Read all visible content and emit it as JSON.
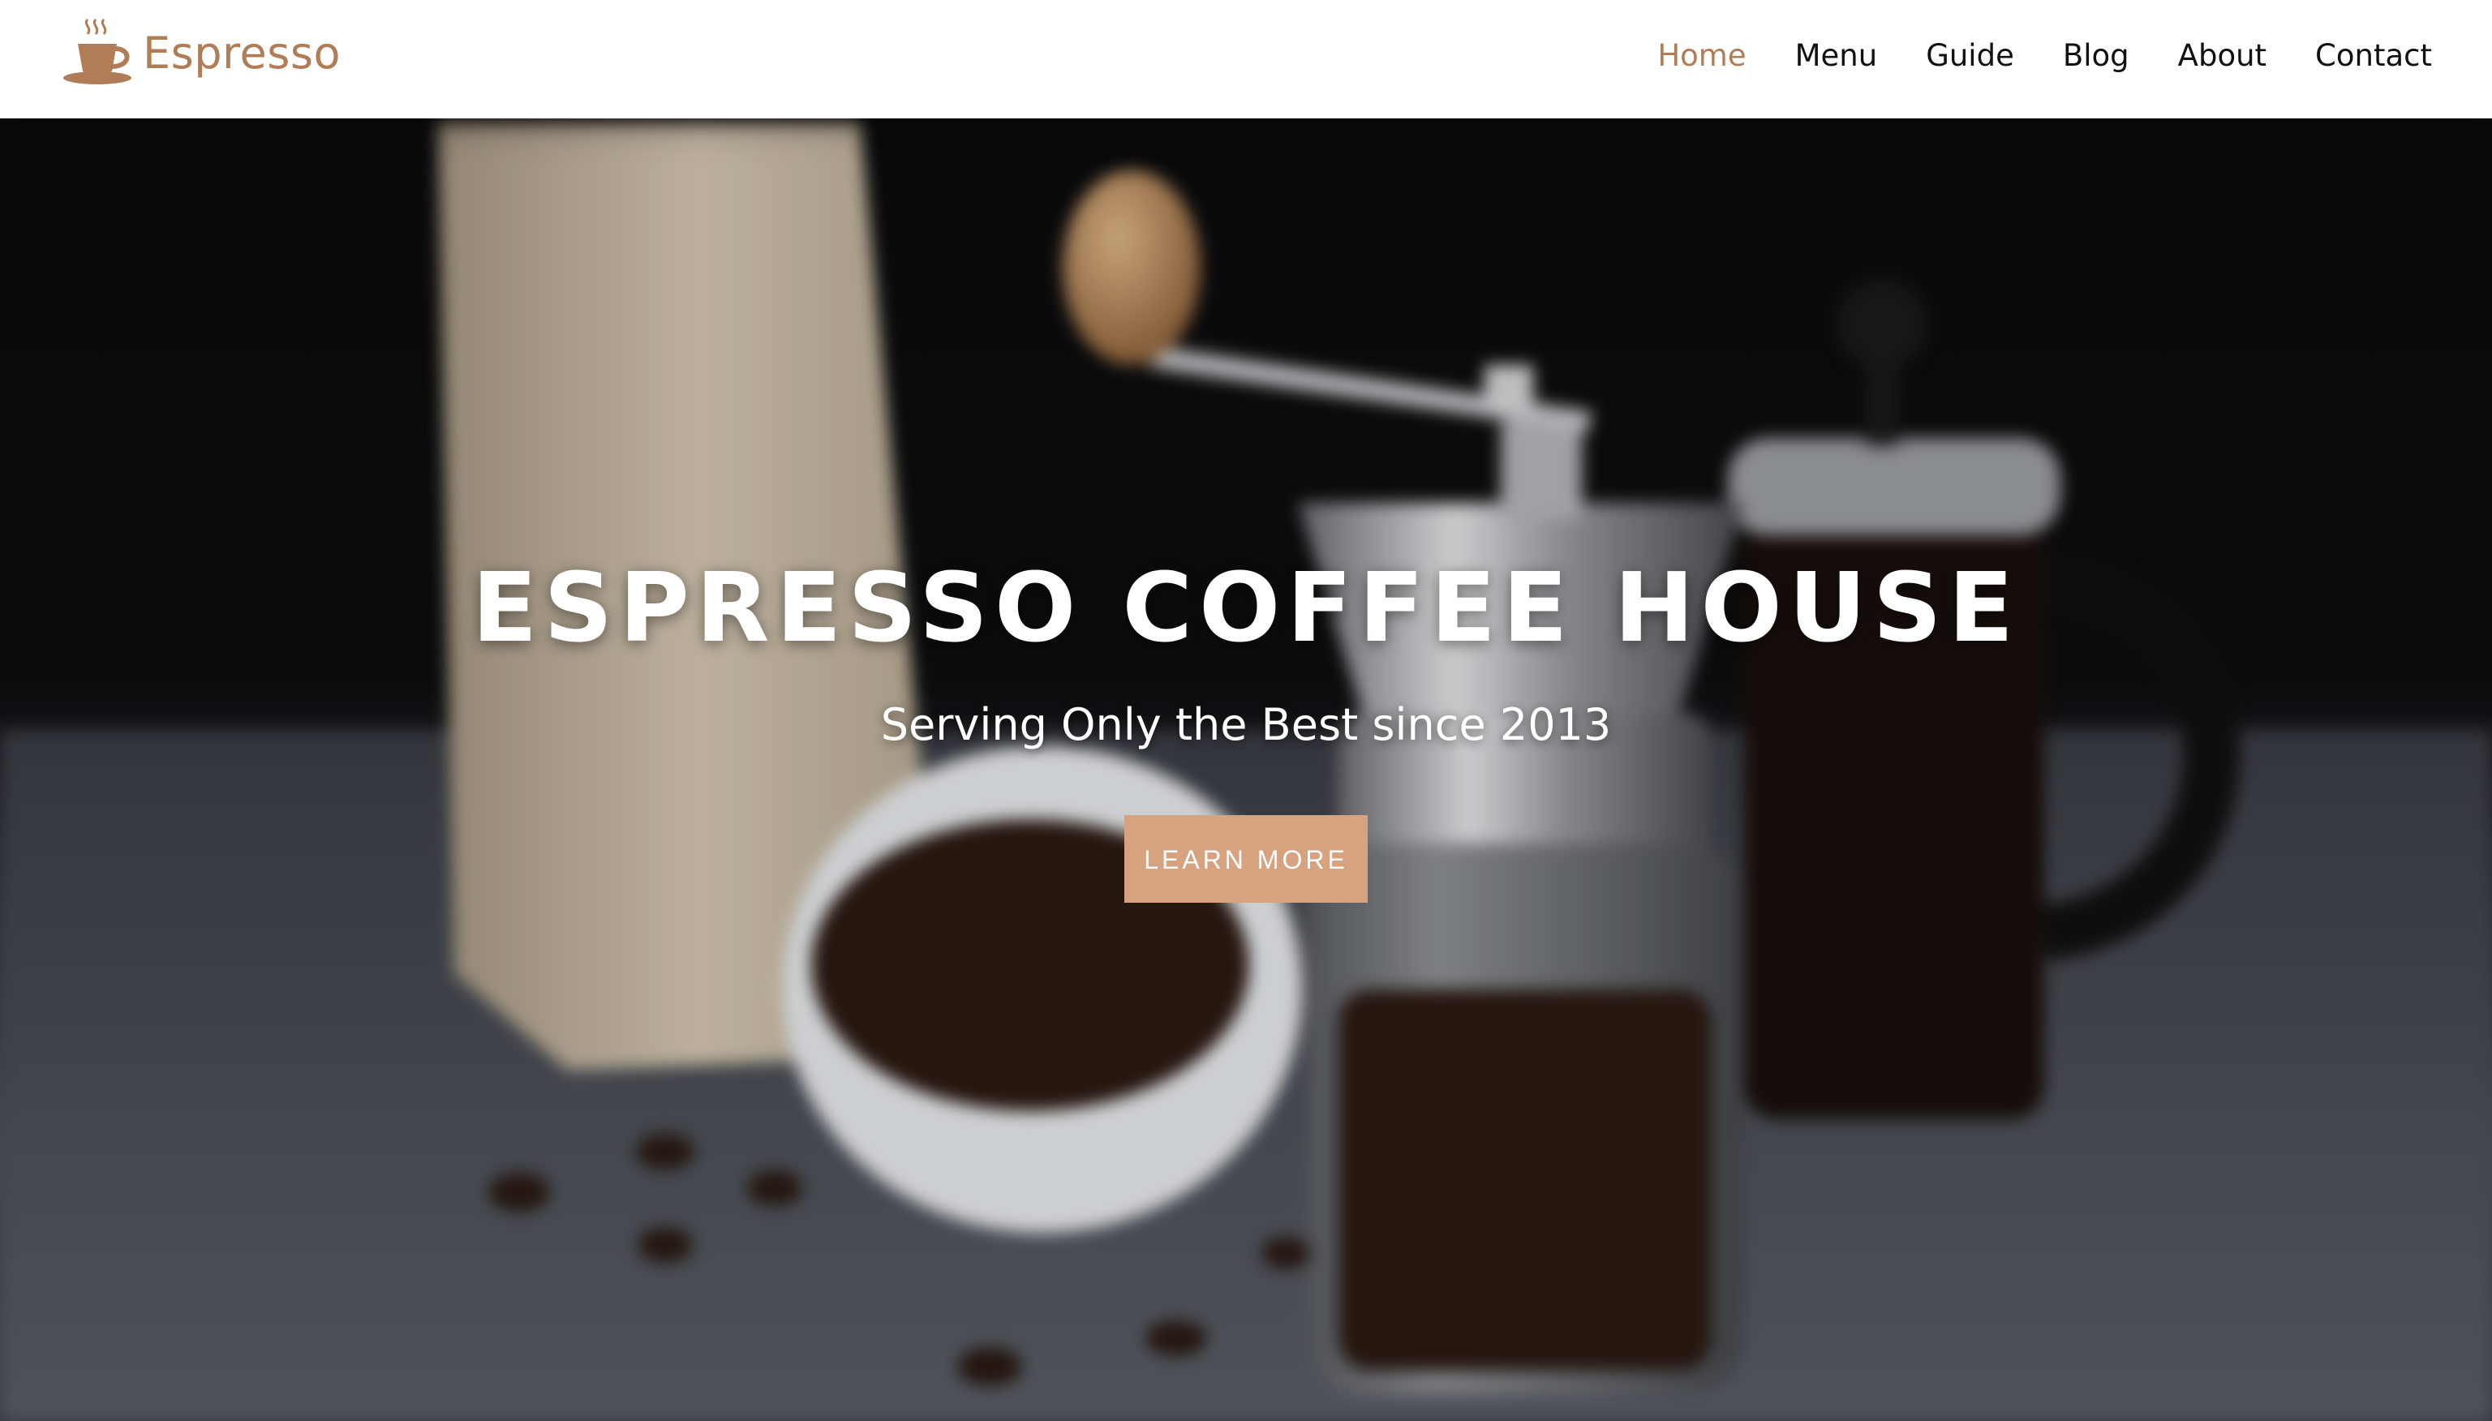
{
  "brand": {
    "name": "Espresso",
    "icon": "coffee-cup-icon",
    "color": "#b07d56"
  },
  "nav": {
    "items": [
      {
        "label": "Home",
        "active": true
      },
      {
        "label": "Menu",
        "active": false
      },
      {
        "label": "Guide",
        "active": false
      },
      {
        "label": "Blog",
        "active": false
      },
      {
        "label": "About",
        "active": false
      },
      {
        "label": "Contact",
        "active": false
      }
    ],
    "active_color": "#b07d56"
  },
  "hero": {
    "title": "ESPRESSO COFFEE HOUSE",
    "subtitle": "Serving Only the Best since 2013",
    "button_label": "LEARN MORE",
    "button_color": "#d6a27f"
  }
}
